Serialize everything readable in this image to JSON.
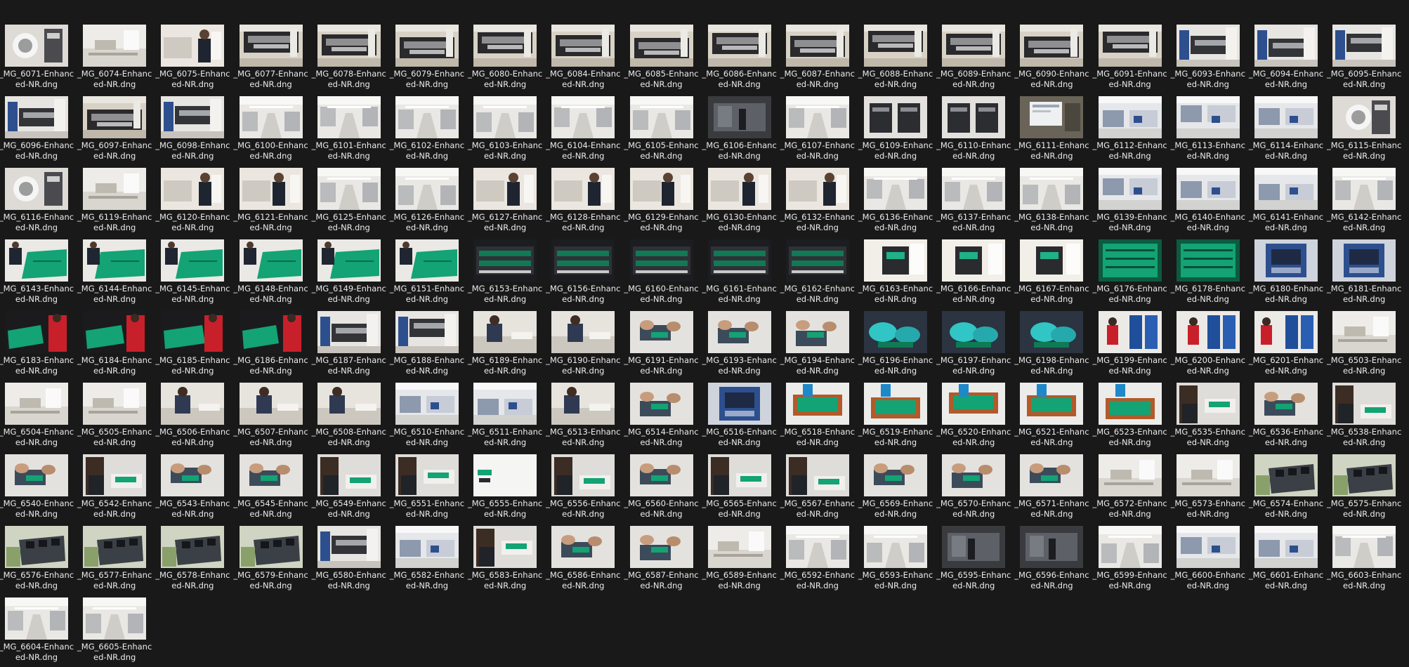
{
  "files": [
    {
      "name": "_MG_6071-Enhanced-NR.dng",
      "scene": "robot"
    },
    {
      "name": "_MG_6074-Enhanced-NR.dng",
      "scene": "lab"
    },
    {
      "name": "_MG_6075-Enhanced-NR.dng",
      "scene": "worker"
    },
    {
      "name": "_MG_6077-Enhanced-NR.dng",
      "scene": "machine"
    },
    {
      "name": "_MG_6078-Enhanced-NR.dng",
      "scene": "machine"
    },
    {
      "name": "_MG_6079-Enhanced-NR.dng",
      "scene": "machine"
    },
    {
      "name": "_MG_6080-Enhanced-NR.dng",
      "scene": "machine"
    },
    {
      "name": "_MG_6084-Enhanced-NR.dng",
      "scene": "machine"
    },
    {
      "name": "_MG_6085-Enhanced-NR.dng",
      "scene": "machine"
    },
    {
      "name": "_MG_6086-Enhanced-NR.dng",
      "scene": "machine"
    },
    {
      "name": "_MG_6087-Enhanced-NR.dng",
      "scene": "machine"
    },
    {
      "name": "_MG_6088-Enhanced-NR.dng",
      "scene": "machine"
    },
    {
      "name": "_MG_6089-Enhanced-NR.dng",
      "scene": "machine"
    },
    {
      "name": "_MG_6090-Enhanced-NR.dng",
      "scene": "machine"
    },
    {
      "name": "_MG_6091-Enhanced-NR.dng",
      "scene": "machine"
    },
    {
      "name": "_MG_6093-Enhanced-NR.dng",
      "scene": "machine-blue"
    },
    {
      "name": "_MG_6094-Enhanced-NR.dng",
      "scene": "machine-blue"
    },
    {
      "name": "_MG_6095-Enhanced-NR.dng",
      "scene": "machine-blue"
    },
    {
      "name": "_MG_6096-Enhanced-NR.dng",
      "scene": "machine-blue"
    },
    {
      "name": "_MG_6097-Enhanced-NR.dng",
      "scene": "machine"
    },
    {
      "name": "_MG_6098-Enhanced-NR.dng",
      "scene": "machine-blue"
    },
    {
      "name": "_MG_6100-Enhanced-NR.dng",
      "scene": "hall"
    },
    {
      "name": "_MG_6101-Enhanced-NR.dng",
      "scene": "hall"
    },
    {
      "name": "_MG_6102-Enhanced-NR.dng",
      "scene": "hall"
    },
    {
      "name": "_MG_6103-Enhanced-NR.dng",
      "scene": "hall"
    },
    {
      "name": "_MG_6104-Enhanced-NR.dng",
      "scene": "hall"
    },
    {
      "name": "_MG_6105-Enhanced-NR.dng",
      "scene": "hall"
    },
    {
      "name": "_MG_6106-Enhanced-NR.dng",
      "scene": "dark-hall"
    },
    {
      "name": "_MG_6107-Enhanced-NR.dng",
      "scene": "hall"
    },
    {
      "name": "_MG_6109-Enhanced-NR.dng",
      "scene": "cabinets"
    },
    {
      "name": "_MG_6110-Enhanced-NR.dng",
      "scene": "cabinets"
    },
    {
      "name": "_MG_6111-Enhanced-NR.dng",
      "scene": "monitor"
    },
    {
      "name": "_MG_6112-Enhanced-NR.dng",
      "scene": "hall-blue"
    },
    {
      "name": "_MG_6113-Enhanced-NR.dng",
      "scene": "hall-blue"
    },
    {
      "name": "_MG_6114-Enhanced-NR.dng",
      "scene": "hall-blue"
    },
    {
      "name": "_MG_6115-Enhanced-NR.dng",
      "scene": "robot"
    },
    {
      "name": "_MG_6116-Enhanced-NR.dng",
      "scene": "robot"
    },
    {
      "name": "_MG_6119-Enhanced-NR.dng",
      "scene": "lab"
    },
    {
      "name": "_MG_6120-Enhanced-NR.dng",
      "scene": "worker"
    },
    {
      "name": "_MG_6121-Enhanced-NR.dng",
      "scene": "worker"
    },
    {
      "name": "_MG_6125-Enhanced-NR.dng",
      "scene": "hall"
    },
    {
      "name": "_MG_6126-Enhanced-NR.dng",
      "scene": "hall"
    },
    {
      "name": "_MG_6127-Enhanced-NR.dng",
      "scene": "worker"
    },
    {
      "name": "_MG_6128-Enhanced-NR.dng",
      "scene": "worker"
    },
    {
      "name": "_MG_6129-Enhanced-NR.dng",
      "scene": "worker"
    },
    {
      "name": "_MG_6130-Enhanced-NR.dng",
      "scene": "worker"
    },
    {
      "name": "_MG_6132-Enhanced-NR.dng",
      "scene": "worker"
    },
    {
      "name": "_MG_6136-Enhanced-NR.dng",
      "scene": "hall"
    },
    {
      "name": "_MG_6137-Enhanced-NR.dng",
      "scene": "hall"
    },
    {
      "name": "_MG_6138-Enhanced-NR.dng",
      "scene": "hall"
    },
    {
      "name": "_MG_6139-Enhanced-NR.dng",
      "scene": "hall-blue"
    },
    {
      "name": "_MG_6140-Enhanced-NR.dng",
      "scene": "hall-blue"
    },
    {
      "name": "_MG_6141-Enhanced-NR.dng",
      "scene": "hall-blue"
    },
    {
      "name": "_MG_6142-Enhanced-NR.dng",
      "scene": "hall"
    },
    {
      "name": "_MG_6143-Enhanced-NR.dng",
      "scene": "pcb-light"
    },
    {
      "name": "_MG_6144-Enhanced-NR.dng",
      "scene": "pcb-light"
    },
    {
      "name": "_MG_6145-Enhanced-NR.dng",
      "scene": "pcb-light"
    },
    {
      "name": "_MG_6148-Enhanced-NR.dng",
      "scene": "pcb-light"
    },
    {
      "name": "_MG_6149-Enhanced-NR.dng",
      "scene": "pcb-light"
    },
    {
      "name": "_MG_6151-Enhanced-NR.dng",
      "scene": "pcb-light"
    },
    {
      "name": "_MG_6153-Enhanced-NR.dng",
      "scene": "rack"
    },
    {
      "name": "_MG_6156-Enhanced-NR.dng",
      "scene": "rack"
    },
    {
      "name": "_MG_6160-Enhanced-NR.dng",
      "scene": "rack"
    },
    {
      "name": "_MG_6161-Enhanced-NR.dng",
      "scene": "rack"
    },
    {
      "name": "_MG_6162-Enhanced-NR.dng",
      "scene": "rack"
    },
    {
      "name": "_MG_6163-Enhanced-NR.dng",
      "scene": "device"
    },
    {
      "name": "_MG_6166-Enhanced-NR.dng",
      "scene": "device"
    },
    {
      "name": "_MG_6167-Enhanced-NR.dng",
      "scene": "device"
    },
    {
      "name": "_MG_6176-Enhanced-NR.dng",
      "scene": "pcb-dark"
    },
    {
      "name": "_MG_6178-Enhanced-NR.dng",
      "scene": "pcb-dark"
    },
    {
      "name": "_MG_6180-Enhanced-NR.dng",
      "scene": "device-blue"
    },
    {
      "name": "_MG_6181-Enhanced-NR.dng",
      "scene": "device-blue"
    },
    {
      "name": "_MG_6183-Enhanced-NR.dng",
      "scene": "pcb-red"
    },
    {
      "name": "_MG_6184-Enhanced-NR.dng",
      "scene": "pcb-red"
    },
    {
      "name": "_MG_6185-Enhanced-NR.dng",
      "scene": "pcb-red"
    },
    {
      "name": "_MG_6186-Enhanced-NR.dng",
      "scene": "pcb-red"
    },
    {
      "name": "_MG_6187-Enhanced-NR.dng",
      "scene": "machine-blue"
    },
    {
      "name": "_MG_6188-Enhanced-NR.dng",
      "scene": "machine-blue"
    },
    {
      "name": "_MG_6189-Enhanced-NR.dng",
      "scene": "seated"
    },
    {
      "name": "_MG_6190-Enhanced-NR.dng",
      "scene": "seated"
    },
    {
      "name": "_MG_6191-Enhanced-NR.dng",
      "scene": "hands"
    },
    {
      "name": "_MG_6193-Enhanced-NR.dng",
      "scene": "hands"
    },
    {
      "name": "_MG_6194-Enhanced-NR.dng",
      "scene": "hands"
    },
    {
      "name": "_MG_6196-Enhanced-NR.dng",
      "scene": "gloves"
    },
    {
      "name": "_MG_6197-Enhanced-NR.dng",
      "scene": "gloves"
    },
    {
      "name": "_MG_6198-Enhanced-NR.dng",
      "scene": "gloves"
    },
    {
      "name": "_MG_6199-Enhanced-NR.dng",
      "scene": "bins"
    },
    {
      "name": "_MG_6200-Enhanced-NR.dng",
      "scene": "bins"
    },
    {
      "name": "_MG_6201-Enhanced-NR.dng",
      "scene": "bins"
    },
    {
      "name": "_MG_6503-Enhanced-NR.dng",
      "scene": "lab"
    },
    {
      "name": "_MG_6504-Enhanced-NR.dng",
      "scene": "lab"
    },
    {
      "name": "_MG_6505-Enhanced-NR.dng",
      "scene": "lab"
    },
    {
      "name": "_MG_6506-Enhanced-NR.dng",
      "scene": "seated"
    },
    {
      "name": "_MG_6507-Enhanced-NR.dng",
      "scene": "seated"
    },
    {
      "name": "_MG_6508-Enhanced-NR.dng",
      "scene": "seated"
    },
    {
      "name": "_MG_6510-Enhanced-NR.dng",
      "scene": "hall-blue"
    },
    {
      "name": "_MG_6511-Enhanced-NR.dng",
      "scene": "hall-blue"
    },
    {
      "name": "_MG_6513-Enhanced-NR.dng",
      "scene": "seated"
    },
    {
      "name": "_MG_6514-Enhanced-NR.dng",
      "scene": "hands"
    },
    {
      "name": "_MG_6516-Enhanced-NR.dng",
      "scene": "device-blue"
    },
    {
      "name": "_MG_6518-Enhanced-NR.dng",
      "scene": "fixture"
    },
    {
      "name": "_MG_6519-Enhanced-NR.dng",
      "scene": "fixture"
    },
    {
      "name": "_MG_6520-Enhanced-NR.dng",
      "scene": "fixture"
    },
    {
      "name": "_MG_6521-Enhanced-NR.dng",
      "scene": "fixture"
    },
    {
      "name": "_MG_6523-Enhanced-NR.dng",
      "scene": "fixture"
    },
    {
      "name": "_MG_6535-Enhanced-NR.dng",
      "scene": "operator"
    },
    {
      "name": "_MG_6536-Enhanced-NR.dng",
      "scene": "hands"
    },
    {
      "name": "_MG_6538-Enhanced-NR.dng",
      "scene": "operator"
    },
    {
      "name": "_MG_6540-Enhanced-NR.dng",
      "scene": "hands"
    },
    {
      "name": "_MG_6542-Enhanced-NR.dng",
      "scene": "operator"
    },
    {
      "name": "_MG_6543-Enhanced-NR.dng",
      "scene": "hands"
    },
    {
      "name": "_MG_6545-Enhanced-NR.dng",
      "scene": "hands"
    },
    {
      "name": "_MG_6549-Enhanced-NR.dng",
      "scene": "operator"
    },
    {
      "name": "_MG_6551-Enhanced-NR.dng",
      "scene": "operator"
    },
    {
      "name": "_MG_6555-Enhanced-NR.dng",
      "scene": "white"
    },
    {
      "name": "_MG_6556-Enhanced-NR.dng",
      "scene": "operator"
    },
    {
      "name": "_MG_6560-Enhanced-NR.dng",
      "scene": "hands"
    },
    {
      "name": "_MG_6565-Enhanced-NR.dng",
      "scene": "operator"
    },
    {
      "name": "_MG_6567-Enhanced-NR.dng",
      "scene": "operator"
    },
    {
      "name": "_MG_6569-Enhanced-NR.dng",
      "scene": "hands"
    },
    {
      "name": "_MG_6570-Enhanced-NR.dng",
      "scene": "hands"
    },
    {
      "name": "_MG_6571-Enhanced-NR.dng",
      "scene": "hands"
    },
    {
      "name": "_MG_6572-Enhanced-NR.dng",
      "scene": "lab"
    },
    {
      "name": "_MG_6573-Enhanced-NR.dng",
      "scene": "lab"
    },
    {
      "name": "_MG_6574-Enhanced-NR.dng",
      "scene": "trays"
    },
    {
      "name": "_MG_6575-Enhanced-NR.dng",
      "scene": "trays"
    },
    {
      "name": "_MG_6576-Enhanced-NR.dng",
      "scene": "trays"
    },
    {
      "name": "_MG_6577-Enhanced-NR.dng",
      "scene": "trays"
    },
    {
      "name": "_MG_6578-Enhanced-NR.dng",
      "scene": "trays"
    },
    {
      "name": "_MG_6579-Enhanced-NR.dng",
      "scene": "trays"
    },
    {
      "name": "_MG_6580-Enhanced-NR.dng",
      "scene": "machine-blue"
    },
    {
      "name": "_MG_6582-Enhanced-NR.dng",
      "scene": "hall-blue"
    },
    {
      "name": "_MG_6583-Enhanced-NR.dng",
      "scene": "operator"
    },
    {
      "name": "_MG_6586-Enhanced-NR.dng",
      "scene": "hands"
    },
    {
      "name": "_MG_6587-Enhanced-NR.dng",
      "scene": "hands"
    },
    {
      "name": "_MG_6589-Enhanced-NR.dng",
      "scene": "lab"
    },
    {
      "name": "_MG_6592-Enhanced-NR.dng",
      "scene": "hall"
    },
    {
      "name": "_MG_6593-Enhanced-NR.dng",
      "scene": "hall"
    },
    {
      "name": "_MG_6595-Enhanced-NR.dng",
      "scene": "dark-hall"
    },
    {
      "name": "_MG_6596-Enhanced-NR.dng",
      "scene": "dark-hall"
    },
    {
      "name": "_MG_6599-Enhanced-NR.dng",
      "scene": "hall"
    },
    {
      "name": "_MG_6600-Enhanced-NR.dng",
      "scene": "hall-blue"
    },
    {
      "name": "_MG_6601-Enhanced-NR.dng",
      "scene": "hall-blue"
    },
    {
      "name": "_MG_6603-Enhanced-NR.dng",
      "scene": "hall"
    },
    {
      "name": "_MG_6604-Enhanced-NR.dng",
      "scene": "hall"
    },
    {
      "name": "_MG_6605-Enhanced-NR.dng",
      "scene": "hall"
    }
  ],
  "colors": {
    "background": "#191919",
    "label": "#eaeaea",
    "pcb_green": "#13a374",
    "machine_blue": "#2d4f8e",
    "accent_red": "#c8202a"
  }
}
